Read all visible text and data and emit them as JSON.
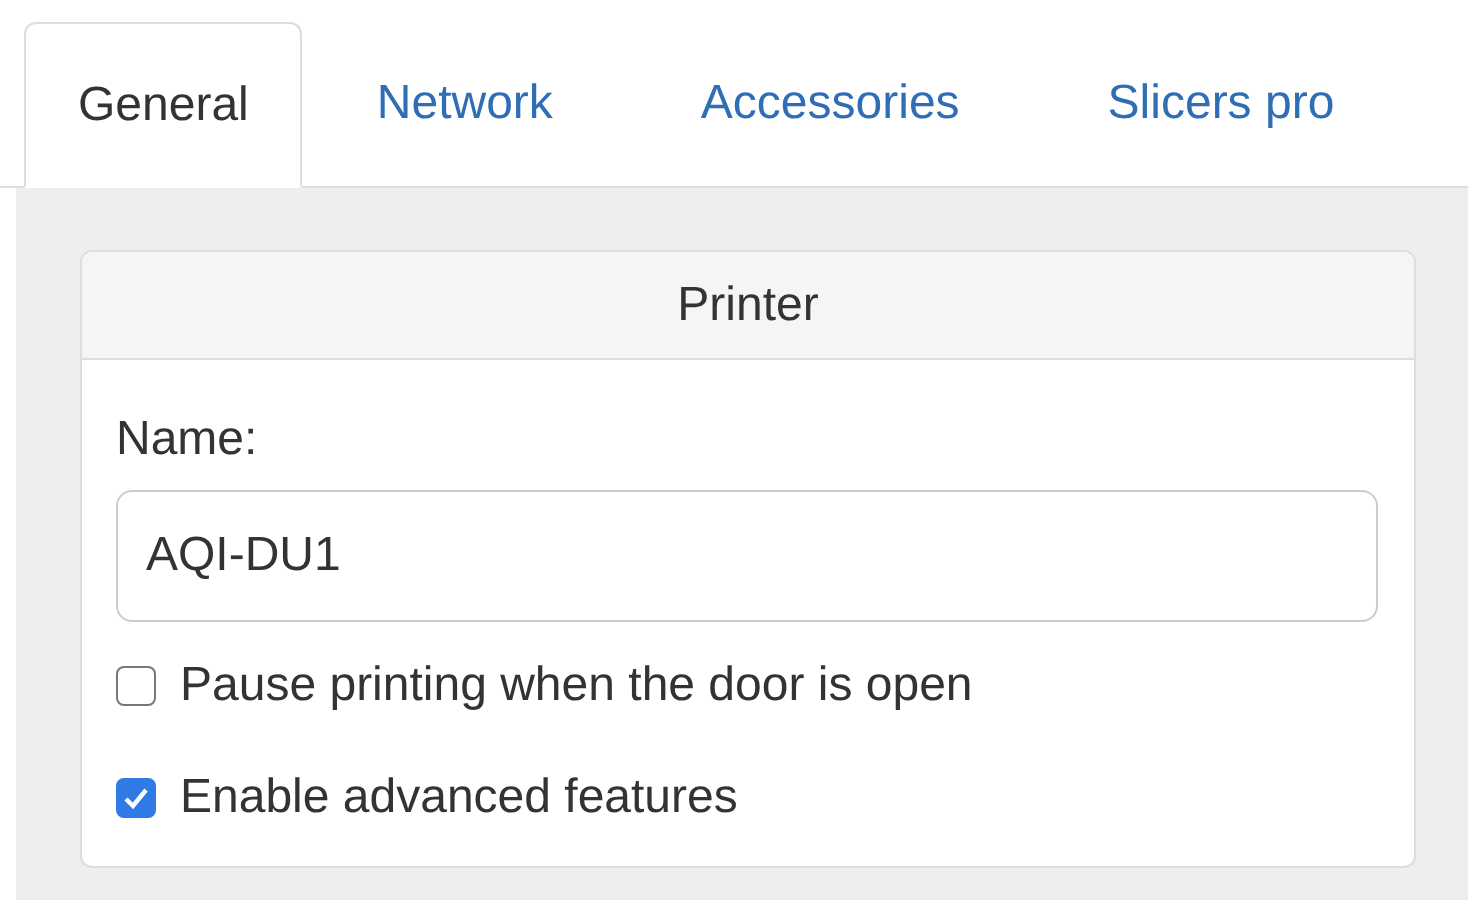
{
  "tabs": [
    {
      "label": "General",
      "selected": true
    },
    {
      "label": "Network",
      "selected": false
    },
    {
      "label": "Accessories",
      "selected": false
    },
    {
      "label": "Slicers pro",
      "selected": false
    }
  ],
  "panel": {
    "title": "Printer",
    "name_label": "Name:",
    "name_value": "AQI-DU1",
    "options": [
      {
        "label": "Pause printing when the door is open",
        "checked": false
      },
      {
        "label": "Enable advanced features",
        "checked": true
      }
    ]
  }
}
